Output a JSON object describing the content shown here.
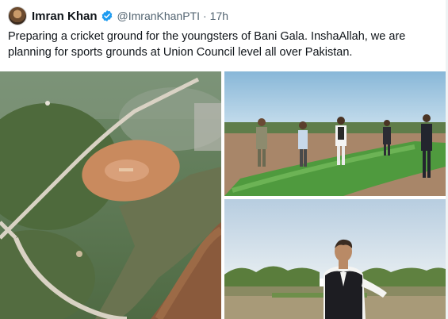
{
  "tweet": {
    "author_name": "Imran Khan",
    "handle": "@ImranKhanPTI",
    "separator": "·",
    "timestamp": "17h",
    "verified_icon": "verified-badge-icon",
    "text": "Preparing a cricket ground for the youngsters of Bani Gala. InshaAllah, we are planning for sports grounds at Union Council level all over Pakistan."
  },
  "colors": {
    "verified_blue": "#1d9bf0",
    "secondary_text": "#536471",
    "primary_text": "#0f1419"
  }
}
